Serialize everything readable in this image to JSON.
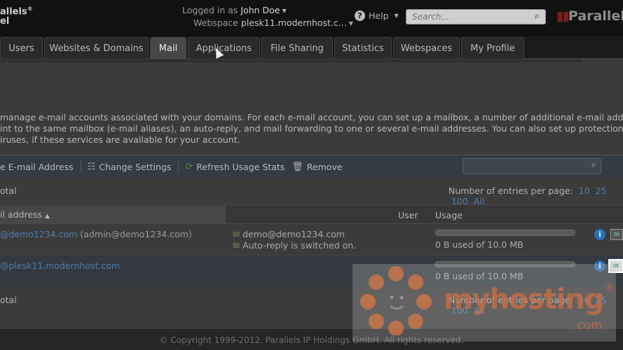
{
  "header": {
    "brand_left_line1": "allels",
    "brand_left_line2": "el",
    "brand_left_mark": "®",
    "logged_in_label": "Logged in as",
    "user_name": "John Doe",
    "webspace_label": "Webspace",
    "webspace_value": "plesk11.modernhost.c...",
    "help_label": "Help",
    "search_placeholder": "Search...",
    "brand_right": "Parallels"
  },
  "tabs": [
    {
      "label": "Users",
      "active": false
    },
    {
      "label": "Websites & Domains",
      "active": false
    },
    {
      "label": "Mail",
      "active": true
    },
    {
      "label": "Applications",
      "active": false
    },
    {
      "label": "File Sharing",
      "active": false
    },
    {
      "label": "Statistics",
      "active": false
    },
    {
      "label": "Webspaces",
      "active": false
    },
    {
      "label": "My Profile",
      "active": false
    }
  ],
  "intro": {
    "line1": "manage e-mail accounts associated with your domains. For each e-mail account, you can set up a mailbox, a number of additional e-mail addresses",
    "line2": "int to the same mailbox (e-mail aliases), an auto-reply, and mail forwarding to one or several e-mail addresses. You can also set up protection from",
    "line3": "iruses, if these services are available for your account."
  },
  "toolbar": {
    "create_label": "e E-mail Address",
    "change_settings_label": "Change Settings",
    "refresh_label": "Refresh Usage Stats",
    "remove_label": "Remove"
  },
  "list": {
    "total_label": "otal",
    "per_page_label": "Number of entries per page:",
    "per_page_options": [
      "10",
      "25",
      "100",
      "All"
    ],
    "columns": {
      "mail": "il address",
      "user": "User",
      "usage": "Usage"
    },
    "rows": [
      {
        "address": "@demo1234.com",
        "alias": "(admin@demo1234.com)",
        "responder": "demo@demo1234.com",
        "autoreply": "Auto-reply is switched on.",
        "usage_text": "0 B used of 10.0 MB",
        "usage_fraction": 0
      },
      {
        "address": "@plesk11.modernhost.com",
        "alias": "",
        "responder": "",
        "autoreply": "",
        "usage_text": "0 B used of 10.0 MB",
        "usage_fraction": 0
      }
    ],
    "bottom_total_label": "otal"
  },
  "footer": {
    "copyright": "© Copyright 1999-2012. Parallels IP Holdings GmbH. All rights reserved."
  },
  "watermark": {
    "text": "myhosting",
    "suffix": ".com",
    "reg": "®"
  }
}
